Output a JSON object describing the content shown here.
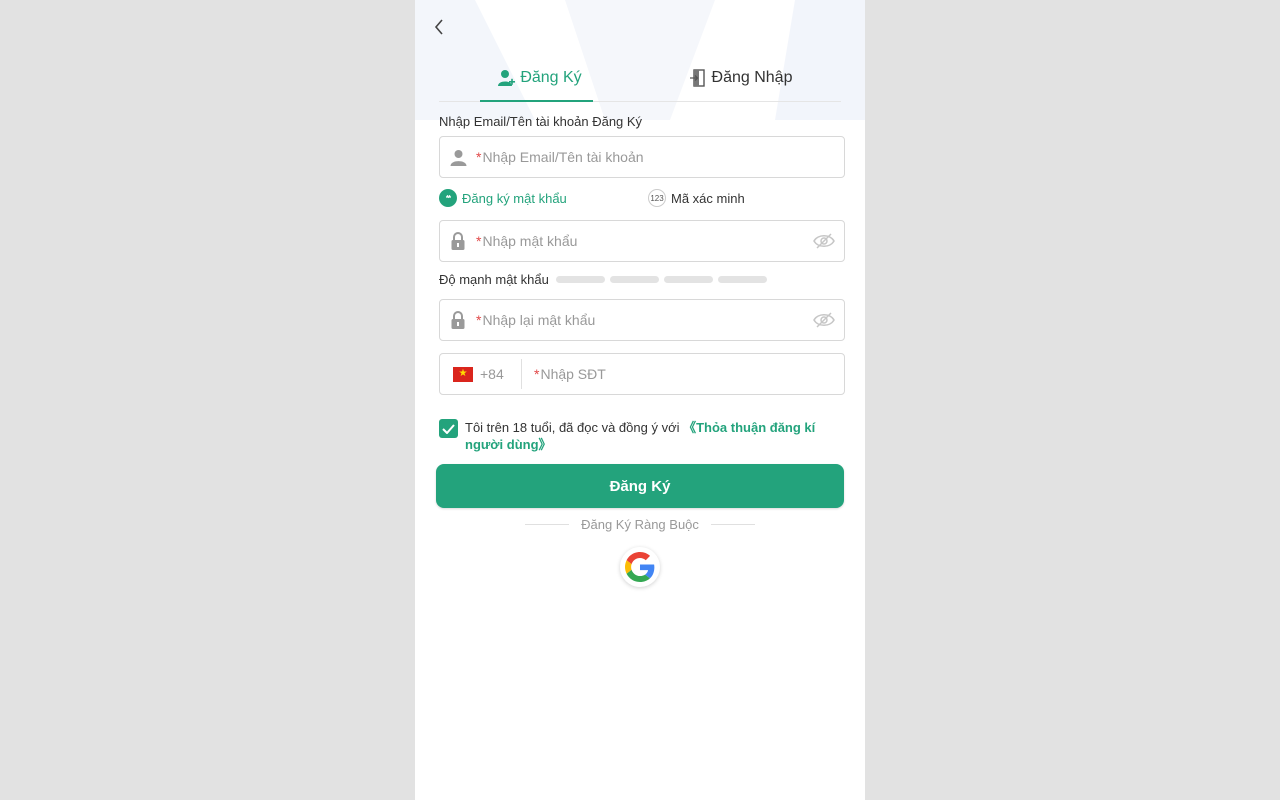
{
  "tabs": [
    {
      "label": "Đăng Ký",
      "active": true,
      "icon": "user-add-icon"
    },
    {
      "label": "Đăng Nhập",
      "active": false,
      "icon": "login-door-icon"
    }
  ],
  "account": {
    "label": "Nhập Email/Tên tài khoản Đăng Ký",
    "required_mark": "*",
    "placeholder": "Nhập Email/Tên tài khoản"
  },
  "modes": [
    {
      "label": "Đăng ký mật khẩu",
      "badge": "**",
      "selected": true
    },
    {
      "label": "Mã xác minh",
      "badge": "123",
      "selected": false
    }
  ],
  "password": {
    "required_mark": "*",
    "placeholder": "Nhập mật khẩu"
  },
  "strength": {
    "label": "Độ mạnh mật khẩu",
    "level": 0,
    "max": 4
  },
  "confirm_password": {
    "required_mark": "*",
    "placeholder": "Nhập lại mật khẩu"
  },
  "phone": {
    "country_code": "+84",
    "flag_symbol": "★",
    "required_mark": "*",
    "placeholder": "Nhập SĐT"
  },
  "agreement": {
    "checked": true,
    "text": "Tôi trên 18 tuổi, đã đọc và đồng ý với ",
    "link": "《Thỏa thuận đăng kí người dùng》"
  },
  "submit_label": "Đăng Ký",
  "divider_label": "Đăng Ký Ràng Buộc",
  "colors": {
    "accent": "#23a37c",
    "required": "#e14848",
    "background": "#e2e2e2"
  }
}
